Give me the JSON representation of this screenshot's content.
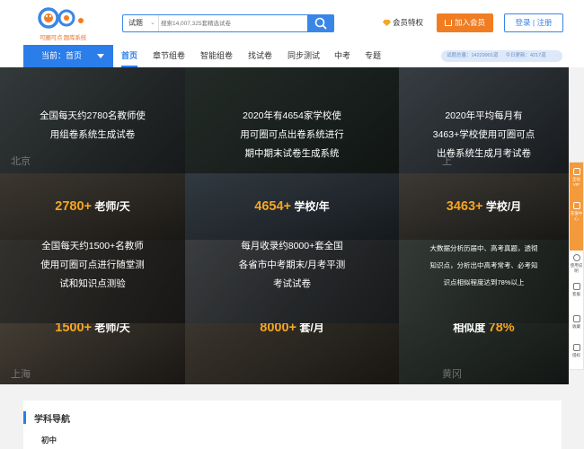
{
  "header": {
    "logo_text": "可圈可点 题库系统",
    "search": {
      "type_label": "试题",
      "placeholder": "搜索14,007,325套精选试卷"
    },
    "vip_label": "会员特权",
    "join_label": "加入会员",
    "auth_label": "登录 | 注册"
  },
  "nav": {
    "current_label": "当前：首页",
    "items": [
      "首页",
      "章节组卷",
      "智能组卷",
      "找试卷",
      "同步测试",
      "中考",
      "专题"
    ],
    "stats": {
      "total_questions": "试题总量：14229901道",
      "today_new": "今日更新：4217道"
    }
  },
  "hero": {
    "tiles": [
      {
        "lines": [
          "全国每天约2780名教师使",
          "用组卷系统生成试卷"
        ],
        "city": "北京"
      },
      {
        "lines": [
          "2020年有4654家学校使",
          "用可圈可点出卷系统进行",
          "期中期末试卷生成系统"
        ],
        "city": ""
      },
      {
        "lines": [
          "2020年平均每月有",
          "3463+学校使用可圈可点",
          "出卷系统生成月考试卷"
        ],
        "city": "上"
      },
      {
        "num": "2780+",
        "unit": "老师/天"
      },
      {
        "num": "4654+",
        "unit": "学校/年"
      },
      {
        "num": "3463+",
        "unit": "学校/月"
      },
      {
        "lines": [
          "全国每天约1500+名教师",
          "使用可圈可点进行随堂测",
          "试和知识点测验"
        ],
        "city": ""
      },
      {
        "lines": [
          "每月收录约8000+套全国",
          "各省市中考期末/月考平测",
          "考试试卷"
        ],
        "city": ""
      },
      {
        "lines": [
          "大数据分析历届中、高考真题，透彻",
          "知识点，分析出中高考常考、必考知",
          "识点相似程度达到78%以上"
        ],
        "city": ""
      },
      {
        "num": "1500+",
        "unit": "老师/天",
        "city": "上海"
      },
      {
        "num": "8000+",
        "unit": "套/月",
        "city": ""
      },
      {
        "prefix": "相似度",
        "num": "78%",
        "city": "黄冈"
      }
    ]
  },
  "sidebar": {
    "items": [
      "全站VIP",
      "充值中心",
      "使用说明",
      "客服",
      "收藏",
      "侵权"
    ]
  },
  "subject_nav": {
    "title": "学科导航",
    "level": "初中"
  },
  "colors": {
    "primary": "#2b7de9",
    "accent_orange": "#f07d22",
    "number_highlight": "#f5a623"
  }
}
